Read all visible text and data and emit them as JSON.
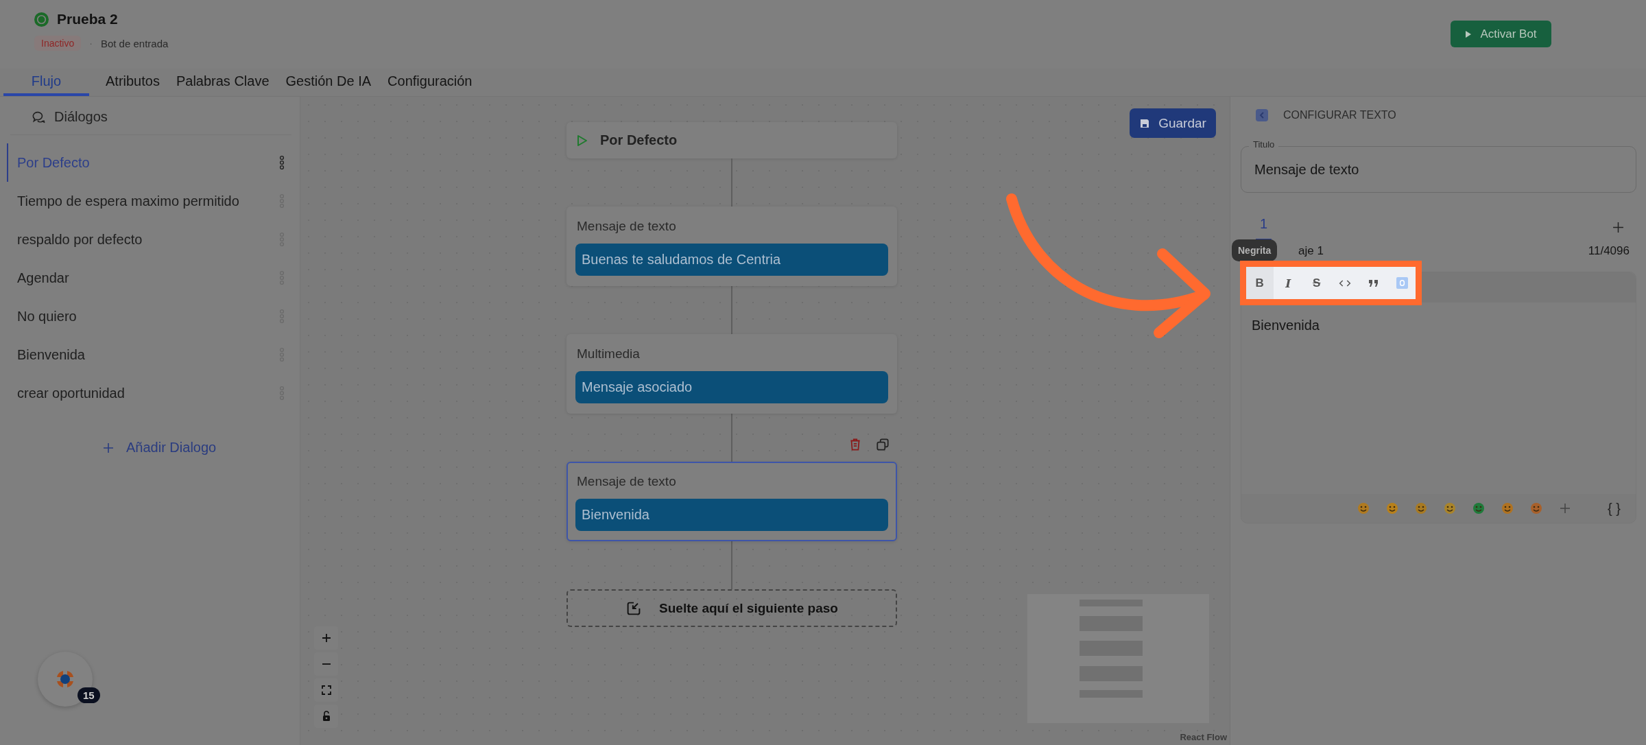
{
  "header": {
    "title": "Prueba 2",
    "status": {
      "label": "Inactivo",
      "active": false
    },
    "separator": "·",
    "subtitle": "Bot de entrada",
    "action_button": "Activar Bot"
  },
  "tabs": [
    {
      "label": "Flujo",
      "selected": true
    },
    {
      "label": "Atributos",
      "selected": false
    },
    {
      "label": "Palabras Clave",
      "selected": false
    },
    {
      "label": "Gestión De IA",
      "selected": false
    },
    {
      "label": "Configuración",
      "selected": false
    }
  ],
  "sidebar": {
    "title": "Diálogos",
    "items": [
      {
        "label": "Por Defecto",
        "selected": true
      },
      {
        "label": "Tiempo de espera maximo permitido",
        "selected": false
      },
      {
        "label": "respaldo por defecto",
        "selected": false
      },
      {
        "label": "Agendar",
        "selected": false
      },
      {
        "label": "No quiero",
        "selected": false
      },
      {
        "label": "Bienvenida",
        "selected": false
      },
      {
        "label": "crear oportunidad",
        "selected": false
      }
    ],
    "add_button": "Añadir Dialogo"
  },
  "canvas": {
    "save_button": "Guardar",
    "nodes": [
      {
        "kind": "start",
        "title": "Por Defecto"
      },
      {
        "kind": "message",
        "title": "Mensaje de texto",
        "content": "Buenas te saludamos de Centria",
        "selected": false
      },
      {
        "kind": "message",
        "title": "Multimedia",
        "content": "Mensaje asociado",
        "selected": false
      },
      {
        "kind": "message",
        "title": "Mensaje de texto",
        "content": "Bienvenida",
        "selected": true
      },
      {
        "kind": "drop",
        "title": "Suelte aquí el siguiente paso"
      }
    ],
    "attribution": "React Flow"
  },
  "chat_widget": {
    "badge": "15"
  },
  "panel": {
    "title": "CONFIGURAR TEXTO",
    "title_field": {
      "label": "Titulo",
      "value": "Mensaje de texto"
    },
    "message_tabs": [
      {
        "label": "1",
        "selected": true
      }
    ],
    "tooltip": "Negrita",
    "message_label": "aje 1",
    "counter": "11/4096",
    "toolbar": [
      {
        "kind": "bold",
        "label": "B",
        "hovered": true
      },
      {
        "kind": "italic",
        "label": "I",
        "hovered": false
      },
      {
        "kind": "strike",
        "label": "S",
        "hovered": false
      },
      {
        "kind": "code",
        "hovered": false
      },
      {
        "kind": "quote",
        "hovered": false
      },
      {
        "kind": "codeblock",
        "hovered": false
      }
    ],
    "text": "Bienvenida",
    "variables_button": "{ }"
  }
}
